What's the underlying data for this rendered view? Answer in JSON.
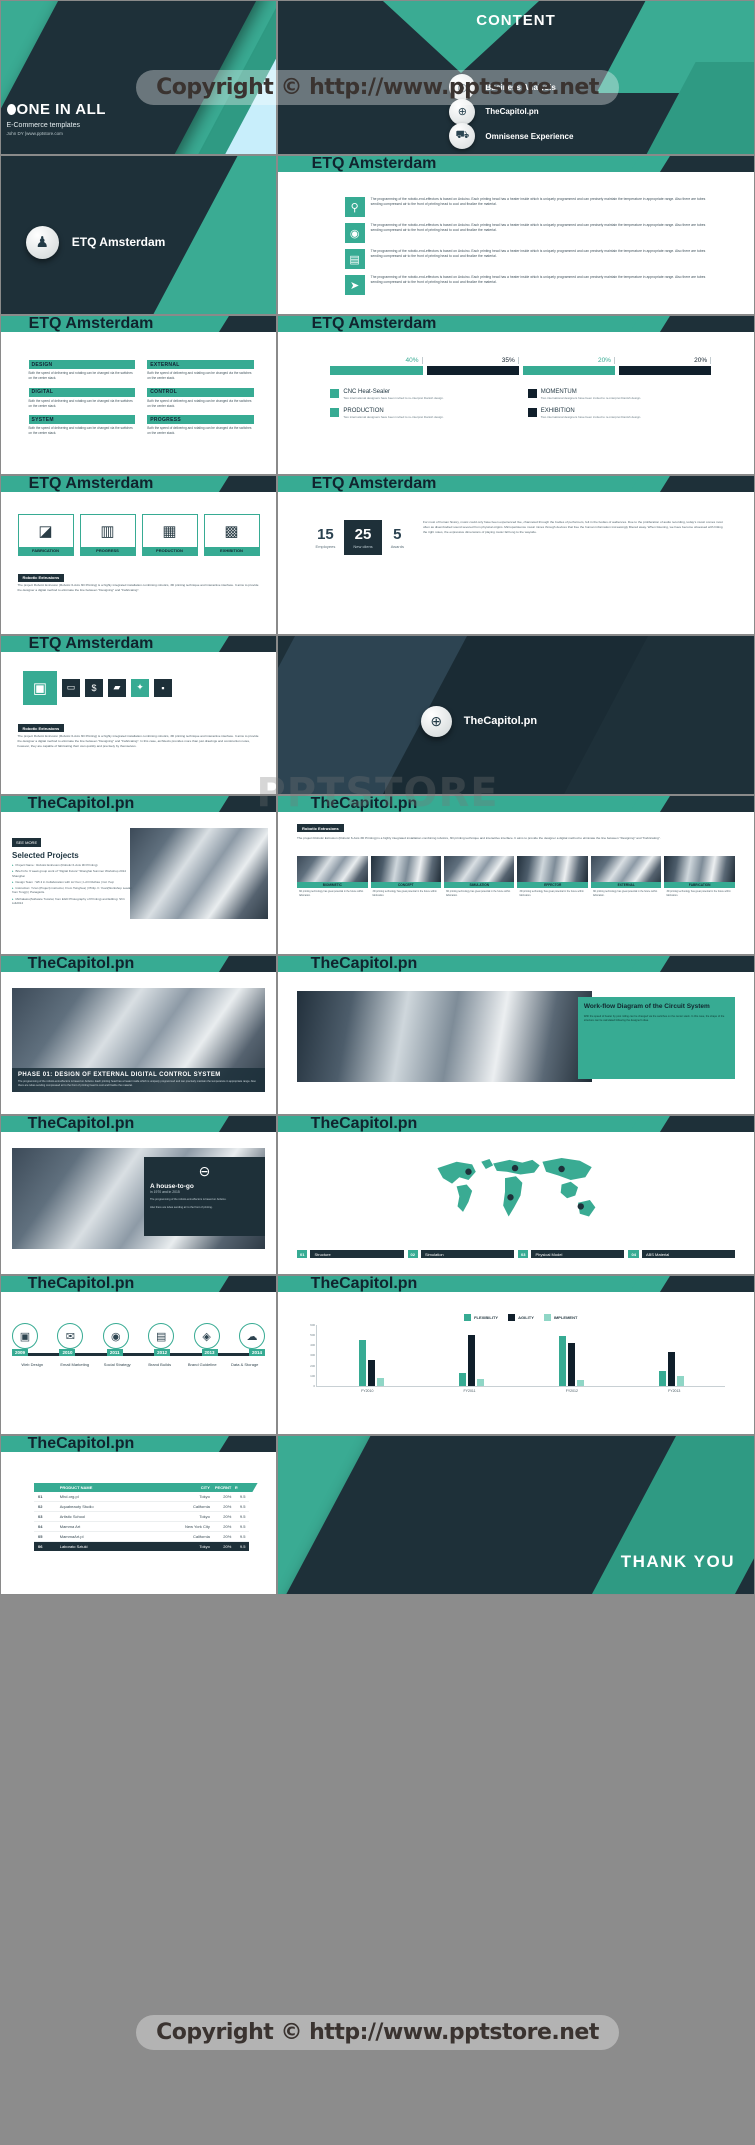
{
  "brand": {
    "teal": "#37ab93",
    "dark": "#1e3039",
    "light_blue": "#c8eefb"
  },
  "watermarks": {
    "top": "Copyright © http://www.pptstore.net",
    "middle": "PPTSTORE",
    "bottom": "Copyright © http://www.pptstore.net"
  },
  "slides": {
    "title": {
      "heading": "ONE IN ALL",
      "subtitle": "E-Commerce templates",
      "byline": "John DY  |www.pptstore.com"
    },
    "content": {
      "heading": "CONTENT",
      "items": [
        {
          "icon": "target-icon",
          "glyph": "◎",
          "label": "Business Analysis"
        },
        {
          "icon": "globe-icon",
          "glyph": "⊕",
          "label": "TheCapitol.pn"
        },
        {
          "icon": "cart-icon",
          "glyph": "⛟",
          "label": "Omnisense Experience"
        }
      ]
    },
    "person": {
      "icon": "user-icon",
      "glyph": "♟",
      "label": "ETQ Amsterdam"
    },
    "header_etq": {
      "icon": "user-icon",
      "label": "ETQ Amsterdam"
    },
    "header_capitol": {
      "icon": "globe-icon",
      "label": "TheCapitol.pn"
    },
    "paragraph_list": {
      "items": [
        {
          "icon": "search-icon",
          "glyph": "🔍",
          "text": "The programming of the robotic-end-effectors  is based on Arduino. Each printing head has a heater inside which is uniquely programmed and can precisely maintain the temperature  in appropriate range. Also there are tubes sending compressed air to the front of printing head to cool and finalize the material."
        },
        {
          "icon": "fingerprint-icon",
          "glyph": "◉",
          "text": "The programming of the robotic-end-effectors  is based on Arduino. Each printing head has a heater inside which is uniquely programmed and can precisely maintain the temperature  in appropriate range. Also there are tubes sending compressed air to the front of printing head to cool and finalize the material."
        },
        {
          "icon": "document-icon",
          "glyph": "▤",
          "text": "The programming of the robotic-end-effectors  is based on Arduino. Each printing head has a heater inside which is uniquely programmed and can precisely maintain the temperature  in appropriate range. Also there are tubes sending compressed air to the front of printing head to cool and finalize the material."
        },
        {
          "icon": "twitter-icon",
          "glyph": "🐦",
          "text": "The programming of the robotic-end-effectors  is based on Arduino. Each printing head has a heater inside which is uniquely programmed and can precisely maintain the temperature  in appropriate range. Also there are tubes sending compressed air to the front of printing head to cool and finalize the material."
        }
      ]
    },
    "six_boxes": {
      "body": "Both the speed of delivering and rotating can be changed via the switches on the center stack.",
      "items": [
        "DESIGN",
        "EXTERNAL",
        "DIGITAL",
        "CONTROL",
        "SYSTEM",
        "PROGRESS"
      ]
    },
    "percent_chart": {
      "legend_body": "Two international designers have been invited to re-interpret Danish design.",
      "items": [
        {
          "value": "40%",
          "label": "CNC Heat-Sealer",
          "color": "#37ab93"
        },
        {
          "value": "35%",
          "label": "MOMENTUM",
          "color": "#101f2b"
        },
        {
          "value": "20%",
          "label": "PRODUCTION",
          "color": "#37ab93"
        },
        {
          "value": "20%",
          "label": "EXHIBITION",
          "color": "#101f2b"
        }
      ]
    },
    "icon_cards": {
      "tag": "Robotic Extrusions",
      "body": "The project Robotic Extrusion (Robotic 6-Axis 3D Printing) is a highly integrated installation combining robotics, 3D printing technique and interactive interface. It aims to provide the designer a digital method to eliminate the line between \"Designing\" and \"Fabricating\".",
      "items": [
        {
          "glyph": "◪",
          "label": "FABRICATION"
        },
        {
          "glyph": "▥",
          "label": "PROGRESS"
        },
        {
          "glyph": "▦",
          "label": "PRODUCTION"
        },
        {
          "glyph": "▩",
          "label": "EXHIBITION"
        }
      ]
    },
    "stats": {
      "items": [
        {
          "number": "15",
          "label": "Employees",
          "style": "plain"
        },
        {
          "number": "25",
          "label": "New cliens",
          "style": "dark"
        },
        {
          "number": "5",
          "label": "Awards",
          "style": "plain"
        }
      ],
      "body": "For most of human history, music could only have been experienced live, channeled through the bodies of performers, felt in the bodies of audiences. Due to the proliferation of audio recording, today's music comes most often as disembodied sound severed from physical origins. Microperistence music mines through devices that free the human information increasingly filtered away. When listening, we have become obsessed with hitting the right notes, the expressive dimensions of playing music fall long to the wayside."
    },
    "squares_row": {
      "tag": "Robotic Extrusions",
      "body": "The project Robotic Extrusion (Robotic 6-Axis 3D Printing) is a highly integrated installation combining robotics, 3D printing technique and interactive interface. It aims to provide the designer a digital method to eliminate the line between \"Designing\" and \"Fabricating\". In this case, architects provides more than just drawings and construction notes, however, they are capable of fabricating their own quickly and precisely by themselves.",
      "glyphs": [
        "▣",
        "▭",
        "$",
        "▰",
        "✦",
        "▪"
      ]
    },
    "capitol_hero": {
      "icon": "globe-icon",
      "label": "TheCapitol.pn"
    },
    "selected_projects": {
      "see_more": "SEE MORE",
      "heading": "Selected Projects",
      "bullets": [
        "Project Name : Robotic Extrusion (Robotic 6-Axis 3D Printing)",
        "Brief Info: 6 week group work of \"Digital Future\" Shanghai Summer Workshop 2014 Shanghai",
        "Design Team : Wh.li in Collaboration with Liz Kun | Ld D Ruthas | Cot Yuqi",
        "Instruction: Yu'an (Project) instructor, From Tsinghua) | Philip. F. Yuan(Workshop Leader, from Tongji) | Panagiotis.",
        "Michalatos(Software Tutorial, from EGD Photography of Printing) and Editing: Sh'n Li&2014"
      ]
    },
    "six_image_cards": {
      "tag": "Robotic Extrusions",
      "body": "The project Robotic Extrusion (Robotic 6-Axis 3D Printing) is a highly integrated installation combining robotics, 3D printing technique and interactive interface. It aims to provide the designer a digital method to eliminate the line between \"Designing\" and \"Fabricating\".",
      "items": [
        {
          "label": "BIOMIMETIC",
          "body": "3D printing technology has great potential in the future within fabrication."
        },
        {
          "label": "CONCEPT",
          "body": "3D printing technology has great potential in the future within fabrication."
        },
        {
          "label": "SIMULATION",
          "body": "3D printing technology has great potential in the future within fabrication."
        },
        {
          "label": "EFFECTOR",
          "body": "3D printing technology has great potential in the future within fabrication."
        },
        {
          "label": "EXTERNAL",
          "body": "3D printing technology has great potential in the future within fabrication."
        },
        {
          "label": "FABRICATION",
          "body": "3D printing technology has great potential in the future within fabrication."
        }
      ]
    },
    "phase_banner": {
      "title": "PHASE 01: DESIGN OF EXTERNAL DIGITAL CONTROL SYSTEM",
      "body": "The programming of the robotic-end-effectors  is based on Arduino. Each printing head has a heater inside which is uniquely programmed and can precisely maintain the temperature  in appropriate range. Also there are tubes sending compressed air to the front of printing head to cool and finalize the material."
    },
    "workflow": {
      "title": "Work-flow Diagram of the Circuit System",
      "body": "With the speed of heater by post rolling can be changed via the switches on the center stack. In this case, the shape of the structure can be calculated following the designer's idea."
    },
    "house_to_go": {
      "glyph": "⊖",
      "title": "A house-to-go",
      "subtitle": "in 1970 and in 2015",
      "bullets": [
        "The programming of the robotic-end-effectors is based on Arduino.",
        "Also there are tubes sending air to the front of printing."
      ]
    },
    "map": {
      "footer": [
        {
          "num": "01",
          "label": "Structure"
        },
        {
          "num": "02",
          "label": "Simulation"
        },
        {
          "num": "03",
          "label": "Physical Model"
        },
        {
          "num": "04",
          "label": "ABS Material"
        }
      ]
    },
    "timeline": {
      "years": [
        "2009",
        "2010",
        "2011",
        "2012",
        "2013",
        "2014"
      ],
      "labels": [
        "Web Design",
        "Email Marketing",
        "Social Strategy",
        "Brand Builds",
        "Brand Guideline",
        "Data & Storage"
      ],
      "glyphs": [
        "▣",
        "✉",
        "◉",
        "▤",
        "◈",
        "☁"
      ]
    },
    "table": {
      "headers": [
        "",
        "PRODUCT NAME",
        "CITY",
        "PECRNT",
        "RATE"
      ],
      "rows": [
        [
          "01",
          "Mhd.org.pl",
          "Tokyo",
          "20%",
          "9.5"
        ],
        [
          "02",
          "Aquabeauty Studio",
          "California",
          "20%",
          "9.5"
        ],
        [
          "03",
          "Artistic School",
          "Tokyo",
          "20%",
          "9.5"
        ],
        [
          "04",
          "Mamma Art",
          "New York City",
          "20%",
          "9.5"
        ],
        [
          "05",
          "MammaArt.pl",
          "California",
          "20%",
          "9.5"
        ],
        [
          "06",
          "Laborato Sztuki",
          "Tokyo",
          "20%",
          "9.5"
        ]
      ]
    },
    "thank_you": {
      "heading": "THANK YOU"
    }
  },
  "chart_data": [
    {
      "type": "bar",
      "orientation": "horizontal",
      "title": "",
      "categories": [
        "CNC Heat-Sealer",
        "MOMENTUM",
        "PRODUCTION",
        "EXHIBITION"
      ],
      "values": [
        40,
        35,
        20,
        20
      ],
      "value_labels": [
        "40%",
        "35%",
        "20%",
        "20%"
      ],
      "colors": [
        "#37ab93",
        "#101f2b",
        "#37ab93",
        "#101f2b"
      ],
      "ylabel": "",
      "xlabel": "",
      "legend": "below"
    },
    {
      "type": "bar",
      "title": "",
      "categories": [
        "FY2010",
        "FY2011",
        "FY2012",
        "FY2013"
      ],
      "series": [
        {
          "name": "FLEXIBILITY",
          "color": "#37ab93",
          "values": [
            450,
            130,
            490,
            150
          ]
        },
        {
          "name": "AGILITY",
          "color": "#101f2b",
          "values": [
            260,
            500,
            420,
            330
          ]
        },
        {
          "name": "IMPLEMENT",
          "color": "#8fd6c6",
          "values": [
            80,
            70,
            60,
            95
          ]
        }
      ],
      "ylim": [
        0,
        600
      ],
      "yticks": [
        0,
        100,
        200,
        300,
        400,
        500,
        600
      ],
      "ylabel": "",
      "xlabel": "",
      "grid": false,
      "legend": "top"
    }
  ]
}
